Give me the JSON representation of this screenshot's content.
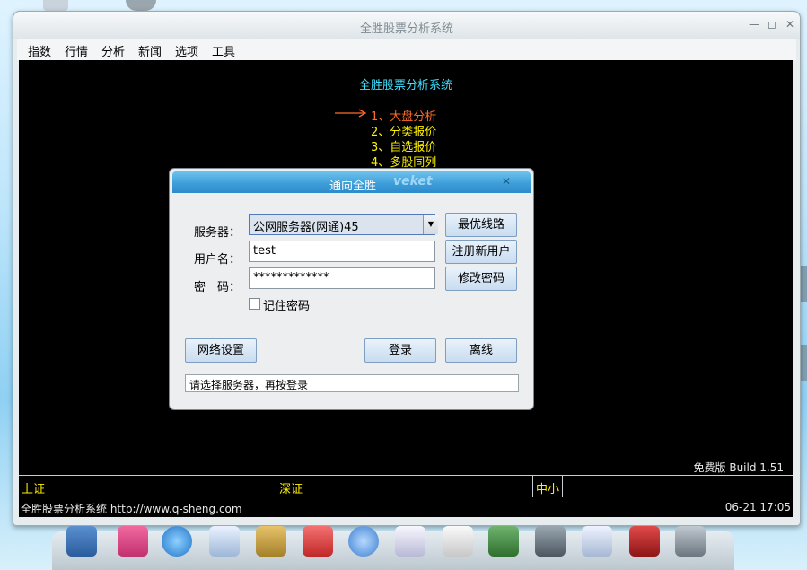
{
  "window": {
    "title": "全胜股票分析系统",
    "min": "—",
    "max": "◻",
    "close": "✕"
  },
  "menu": [
    "指数",
    "行情",
    "分析",
    "新闻",
    "选项",
    "工具"
  ],
  "screen": {
    "title": "全胜股票分析系统",
    "options": [
      "1、大盘分析",
      "2、分类报价",
      "3、自选报价",
      "4、多股同列"
    ],
    "build": "免费版 Build 1.51",
    "markets": [
      "上证",
      "深证",
      "中小"
    ],
    "footer_left": "全胜股票分析系统 http://www.q-sheng.com",
    "footer_right": "06-21 17:05"
  },
  "dialog": {
    "title": "通向全胜",
    "watermark": "veket",
    "close": "✕",
    "server_label": "服务器：",
    "server_value": "公网服务器(网通)45",
    "user_label": "用户名：",
    "user_value": "test",
    "pass_label": "密　码：",
    "pass_value": "*************",
    "best_route": "最优线路",
    "register": "注册新用户",
    "change_pwd": "修改密码",
    "remember": "记住密码",
    "network": "网络设置",
    "login": "登录",
    "offline": "离线",
    "status": "请选择服务器，再按登录"
  },
  "colors": {
    "arrow": "#ff6a2a",
    "option_active": "#ff6a2a",
    "option": "#fff200",
    "title_cyan": "#40e0ff"
  }
}
